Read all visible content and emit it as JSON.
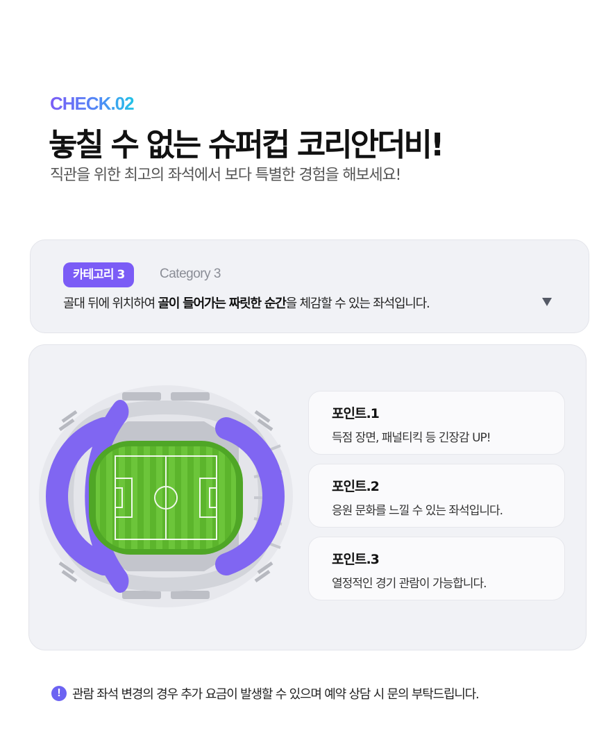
{
  "header": {
    "eyebrow": "CHECK.02",
    "headline": "놓칠 수 없는 슈퍼컵 코리안더비!",
    "subhead": "직관을 위한 최고의 좌석에서 보다 특별한 경험을 해보세요!"
  },
  "category": {
    "badge": "카테고리 3",
    "english": "Category 3",
    "desc_before": "골대 뒤에 위치하여 ",
    "desc_bold": "골이 들어가는 짜릿한 순간",
    "desc_after": "을 체감할 수 있는 좌석입니다.",
    "dropdown_icon": "triangle-down"
  },
  "points": [
    {
      "title": "포인트.1",
      "text": "득점 장면, 패널티킥 등 긴장감 UP!"
    },
    {
      "title": "포인트.2",
      "text": "응원 문화를 느낄 수 있는 좌석입니다."
    },
    {
      "title": "포인트.3",
      "text": "열정적인 경기 관람이 가능합니다."
    }
  ],
  "notice": {
    "icon": "!",
    "text": "관람 좌석 변경의 경우 추가 요금이 발생할 수 있으며 예약 상담 시 문의 부탁드립니다."
  },
  "colors": {
    "accent": "#7b5cf6",
    "highlight_seats": "#8066f2",
    "pitch": "#5dbb2d",
    "card_bg": "#f1f2f6"
  }
}
